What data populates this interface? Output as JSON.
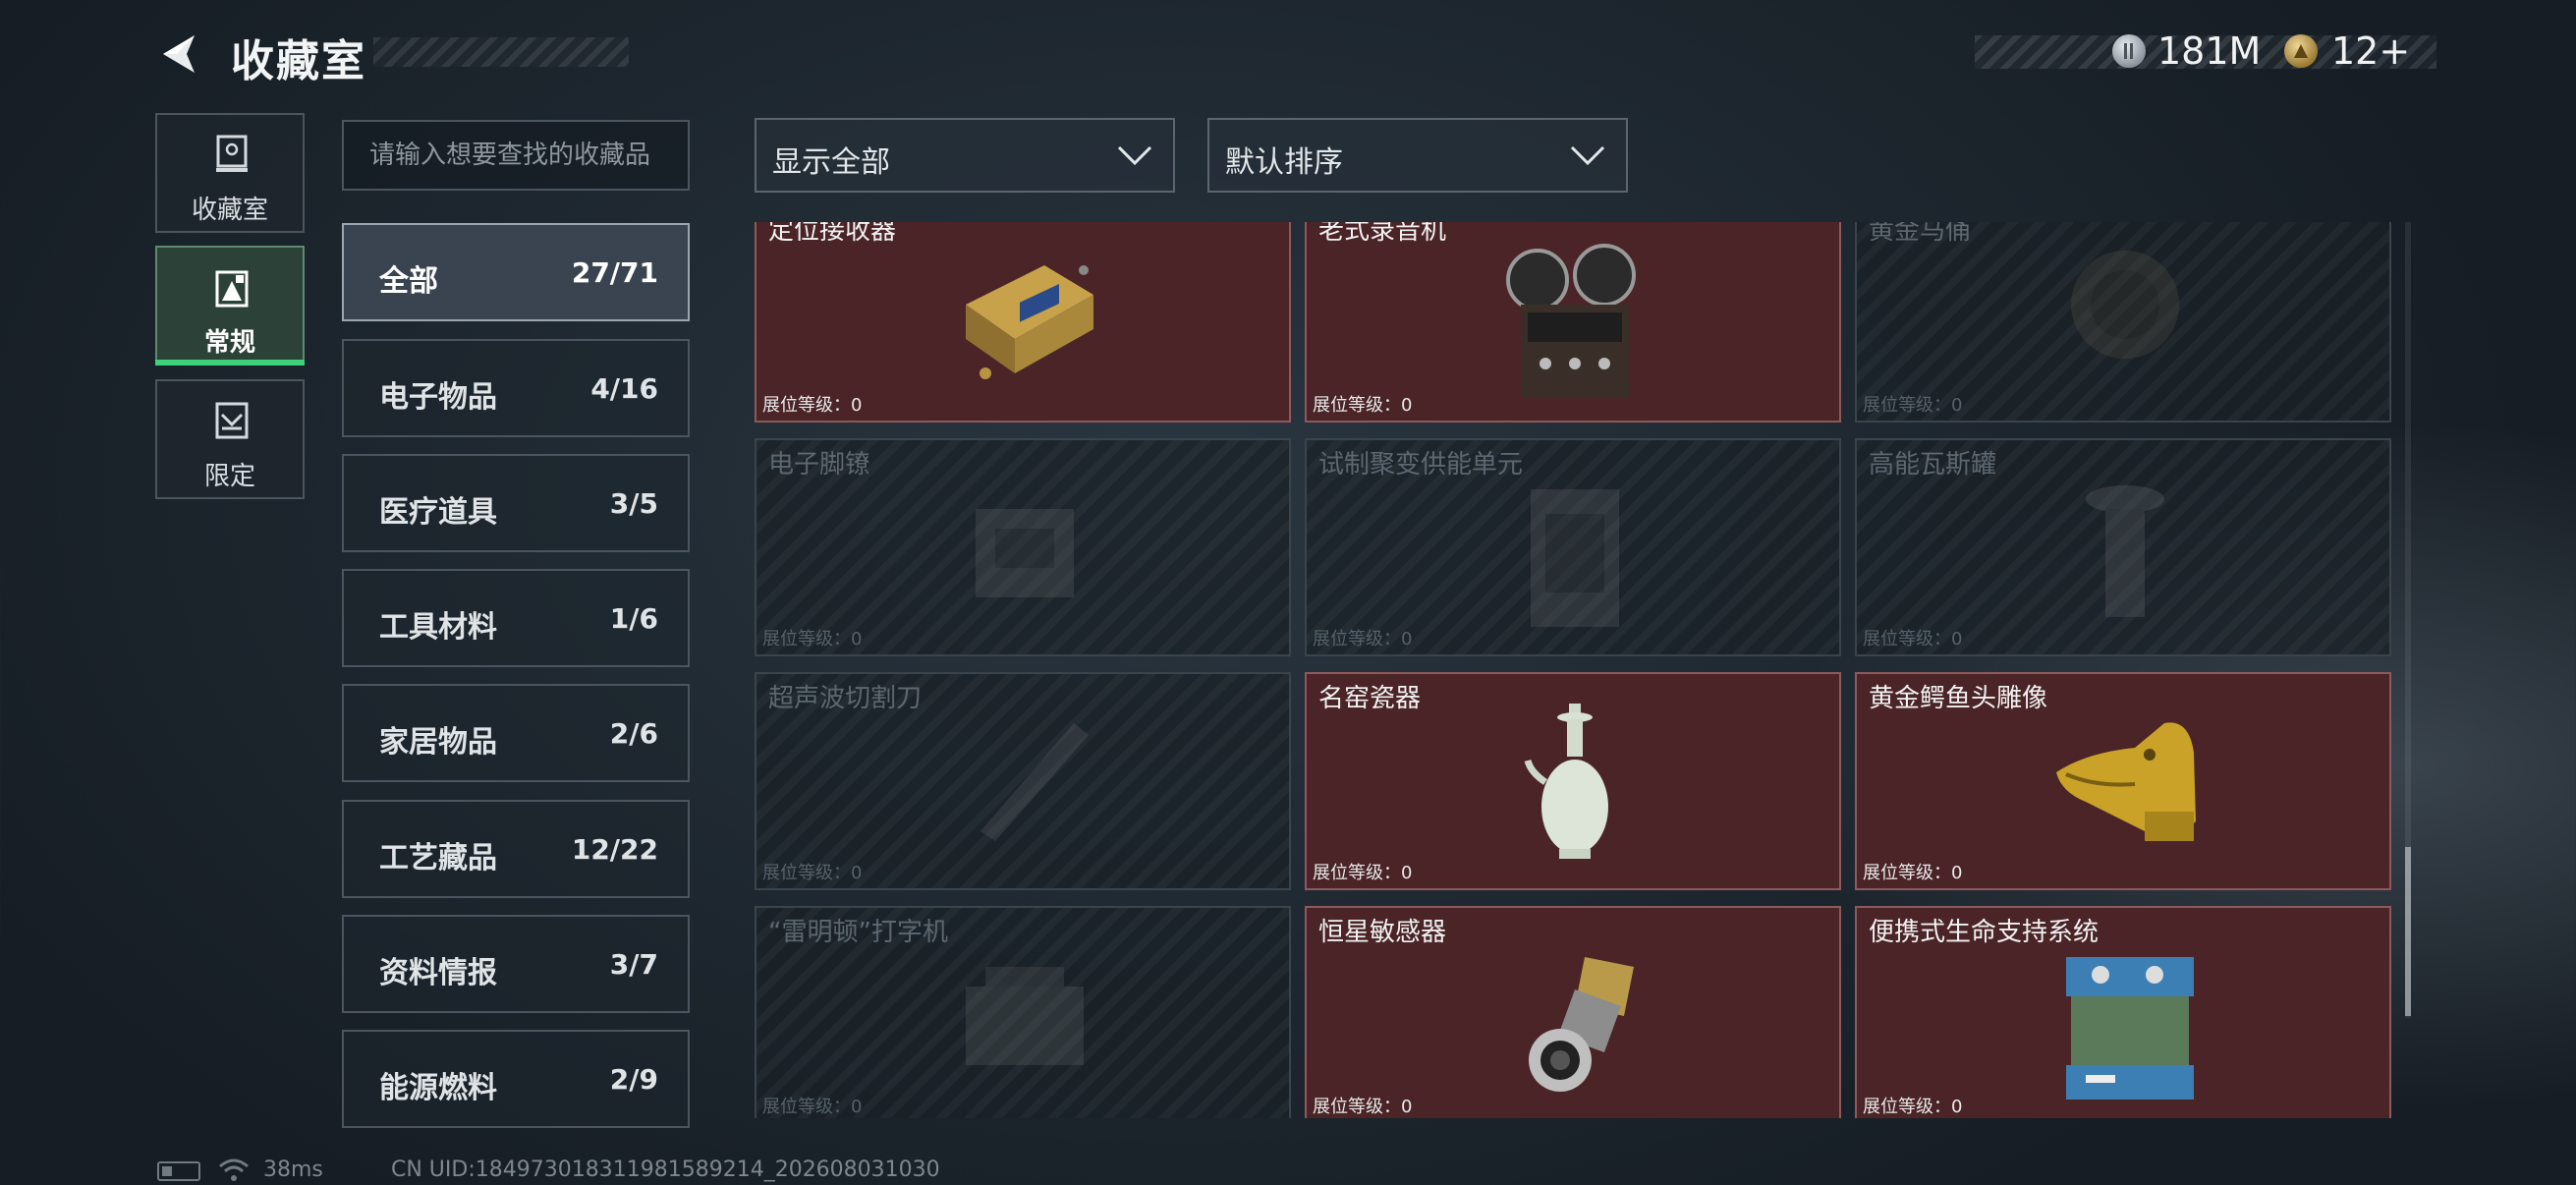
{
  "header": {
    "title": "收藏室",
    "currencies": [
      {
        "icon": "silver-coin-icon",
        "value": "181M"
      },
      {
        "icon": "gold-coin-icon",
        "value": "12+"
      }
    ]
  },
  "nav": {
    "items": [
      {
        "label": "收藏室",
        "icon": "collection-cabinet-icon"
      },
      {
        "label": "常规",
        "icon": "regular-chart-icon",
        "active": true
      },
      {
        "label": "限定",
        "icon": "limited-icon"
      }
    ]
  },
  "search": {
    "placeholder": "请输入想要查找的收藏品"
  },
  "filters": {
    "display": "显示全部",
    "sort": "默认排序"
  },
  "categories": [
    {
      "name": "全部",
      "count": "27/71",
      "active": true
    },
    {
      "name": "电子物品",
      "count": "4/16"
    },
    {
      "name": "医疗道具",
      "count": "3/5"
    },
    {
      "name": "工具材料",
      "count": "1/6"
    },
    {
      "name": "家居物品",
      "count": "2/6"
    },
    {
      "name": "工艺藏品",
      "count": "12/22"
    },
    {
      "name": "资料情报",
      "count": "3/7"
    },
    {
      "name": "能源燃料",
      "count": "2/9"
    }
  ],
  "level_label": "展位等级：0",
  "items": [
    {
      "name": "定位接收器",
      "owned": true,
      "art": "locator-receiver"
    },
    {
      "name": "老式录音机",
      "owned": true,
      "art": "reel-recorder"
    },
    {
      "name": "黄金马俑",
      "owned": false,
      "art": "round-relic"
    },
    {
      "name": "电子脚镣",
      "owned": false,
      "art": "box"
    },
    {
      "name": "试制聚变供能单元",
      "owned": false,
      "art": "box"
    },
    {
      "name": "高能瓦斯罐",
      "owned": false,
      "art": "canister"
    },
    {
      "name": "超声波切割刀",
      "owned": false,
      "art": "knife"
    },
    {
      "name": "名窑瓷器",
      "owned": true,
      "art": "porcelain-vase"
    },
    {
      "name": "黄金鳄鱼头雕像",
      "owned": true,
      "art": "gold-croc-head"
    },
    {
      "name": "“雷明顿”打字机",
      "owned": false,
      "art": "box"
    },
    {
      "name": "恒星敏感器",
      "owned": true,
      "art": "star-sensor"
    },
    {
      "name": "便携式生命支持系统",
      "owned": true,
      "art": "life-support"
    }
  ],
  "footer": {
    "ping": "38ms",
    "uid": "CN UID:18497301831198158​9214_202608031030"
  },
  "colors": {
    "owned_card": "#4a2427",
    "accent_green": "#3fd07a"
  }
}
